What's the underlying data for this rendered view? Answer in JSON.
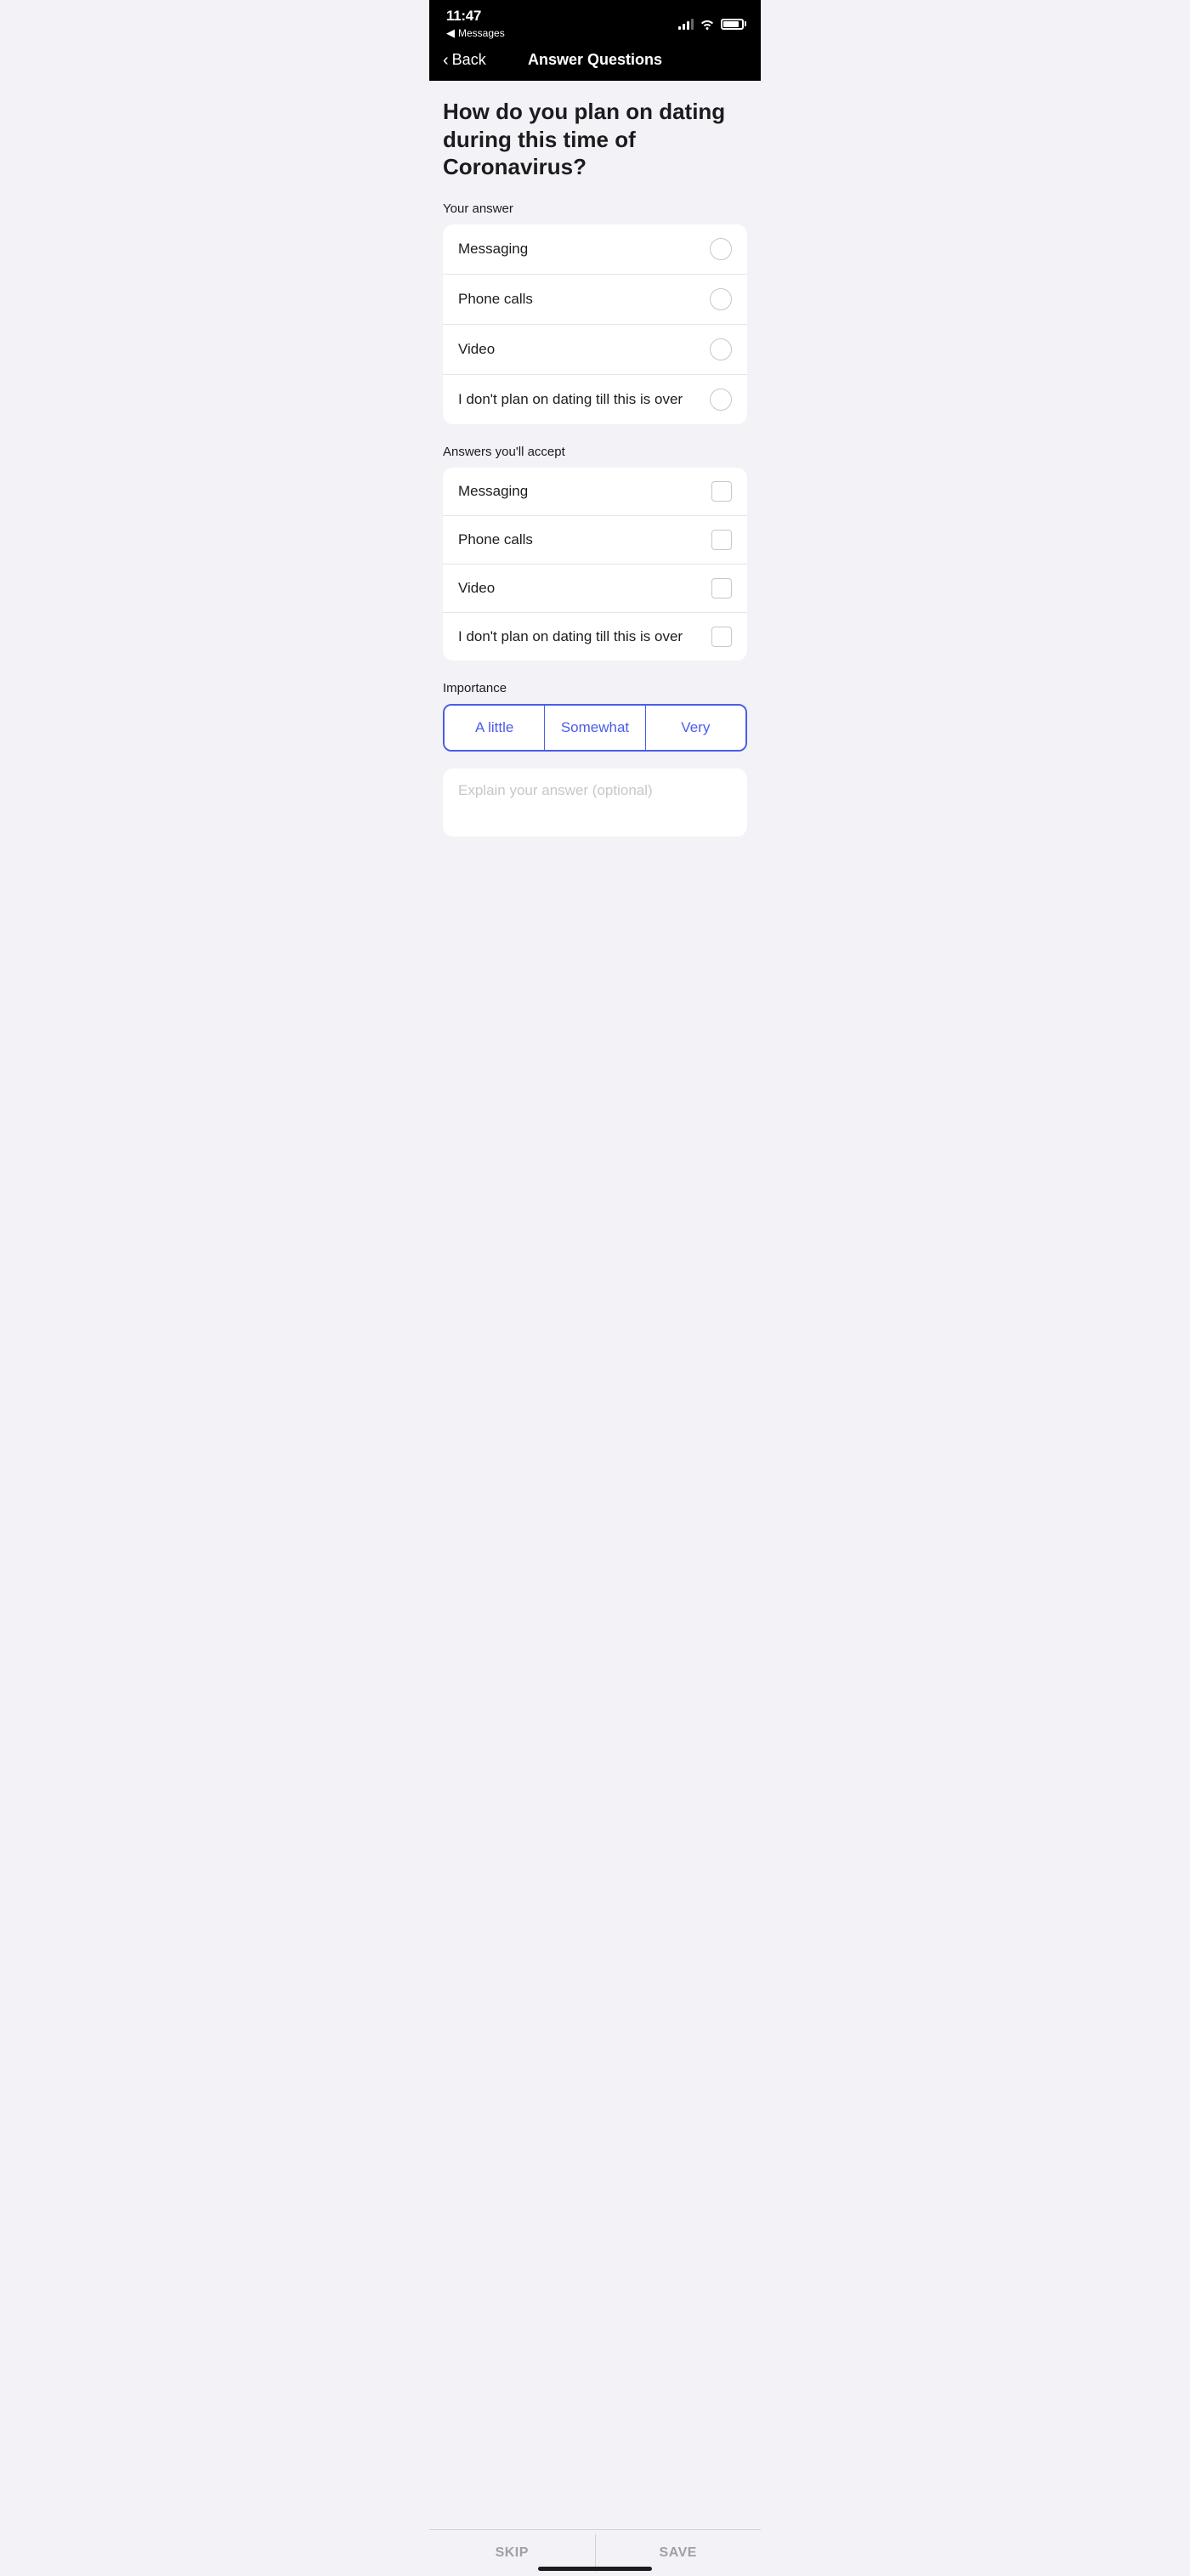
{
  "statusBar": {
    "time": "11:47",
    "messages": "Messages"
  },
  "navBar": {
    "backLabel": "Back",
    "title": "Answer Questions"
  },
  "question": {
    "text": "How do you plan on dating during this time of Coronavirus?"
  },
  "yourAnswer": {
    "label": "Your answer",
    "options": [
      {
        "id": "messaging-radio",
        "label": "Messaging"
      },
      {
        "id": "phone-calls-radio",
        "label": "Phone calls"
      },
      {
        "id": "video-radio",
        "label": "Video"
      },
      {
        "id": "no-plan-radio",
        "label": "I don't plan on dating till this is over"
      }
    ]
  },
  "acceptableAnswers": {
    "label": "Answers you'll accept",
    "options": [
      {
        "id": "messaging-check",
        "label": "Messaging"
      },
      {
        "id": "phone-calls-check",
        "label": "Phone calls"
      },
      {
        "id": "video-check",
        "label": "Video"
      },
      {
        "id": "no-plan-check",
        "label": "I don't plan on dating till this is over"
      }
    ]
  },
  "importance": {
    "label": "Importance",
    "buttons": [
      {
        "id": "a-little",
        "label": "A little"
      },
      {
        "id": "somewhat",
        "label": "Somewhat"
      },
      {
        "id": "very",
        "label": "Very"
      }
    ]
  },
  "explainInput": {
    "placeholder": "Explain your answer (optional)"
  },
  "bottomBar": {
    "skipLabel": "SKIP",
    "saveLabel": "SAVE"
  }
}
